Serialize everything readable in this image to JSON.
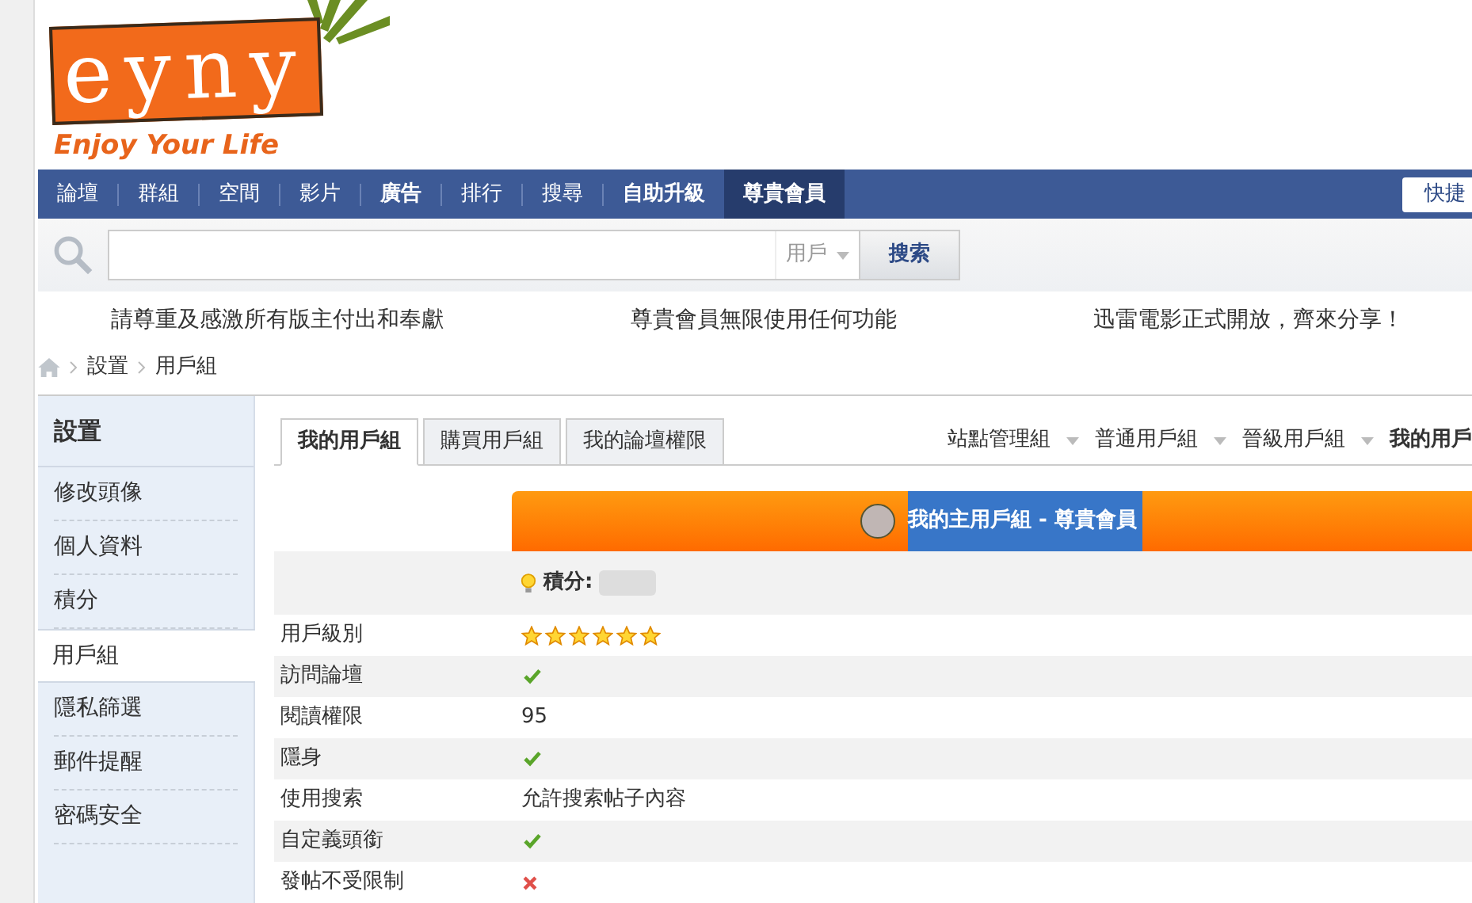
{
  "logo": {
    "letters": "eyny",
    "tagline": "Enjoy Your Life"
  },
  "nav": {
    "items": [
      {
        "label": "論壇",
        "bold": false,
        "selected": false
      },
      {
        "label": "群組",
        "bold": false,
        "selected": false
      },
      {
        "label": "空間",
        "bold": false,
        "selected": false
      },
      {
        "label": "影片",
        "bold": false,
        "selected": false
      },
      {
        "label": "廣告",
        "bold": true,
        "selected": false
      },
      {
        "label": "排行",
        "bold": false,
        "selected": false
      },
      {
        "label": "搜尋",
        "bold": false,
        "selected": false
      },
      {
        "label": "自助升級",
        "bold": true,
        "selected": false
      },
      {
        "label": "尊貴會員",
        "bold": true,
        "selected": true
      }
    ],
    "quick_button": "快捷"
  },
  "search": {
    "scope": "用戶",
    "button": "搜索"
  },
  "notices": [
    "請尊重及感激所有版主付出和奉獻",
    "尊貴會員無限使用任何功能",
    "迅雷電影正式開放，齊來分享！"
  ],
  "breadcrumb": [
    "設置",
    "用戶組"
  ],
  "sidebar": {
    "title": "設置",
    "items": [
      {
        "label": "修改頭像",
        "selected": false
      },
      {
        "label": "個人資料",
        "selected": false
      },
      {
        "label": "積分",
        "selected": false
      },
      {
        "label": "用戶組",
        "selected": true
      },
      {
        "label": "隱私篩選",
        "selected": false
      },
      {
        "label": "郵件提醒",
        "selected": false
      },
      {
        "label": "密碼安全",
        "selected": false
      }
    ]
  },
  "tabs": [
    {
      "label": "我的用戶組",
      "selected": true
    },
    {
      "label": "購買用戶組",
      "selected": false
    },
    {
      "label": "我的論壇權限",
      "selected": false
    }
  ],
  "group_tabs": [
    {
      "label": "站點管理組",
      "selected": false
    },
    {
      "label": "普通用戶組",
      "selected": false
    },
    {
      "label": "晉級用戶組",
      "selected": false
    },
    {
      "label": "我的用戶",
      "selected": true
    }
  ],
  "banner": "我的主用戶組 - 尊貴會員",
  "points_label": "積分:",
  "rows": [
    {
      "label": "用戶級別",
      "kind": "stars",
      "stars": 6
    },
    {
      "label": "訪問論壇",
      "kind": "check",
      "allowed": true
    },
    {
      "label": "閱讀權限",
      "kind": "text",
      "value": "95"
    },
    {
      "label": "隱身",
      "kind": "check",
      "allowed": true
    },
    {
      "label": "使用搜索",
      "kind": "text",
      "value": "允許搜索帖子內容"
    },
    {
      "label": "自定義頭銜",
      "kind": "check",
      "allowed": true
    },
    {
      "label": "發帖不受限制",
      "kind": "check",
      "allowed": false
    }
  ]
}
